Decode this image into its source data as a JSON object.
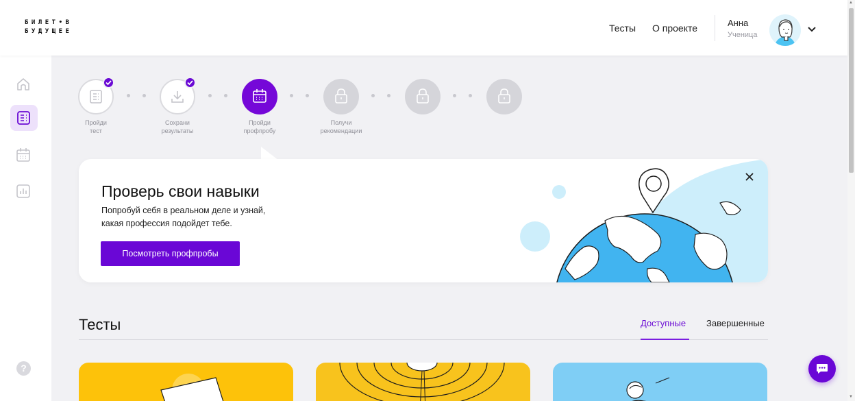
{
  "logo": {
    "line1": "БИЛЕТ•В",
    "line2": "БУДУЩЕЕ"
  },
  "header": {
    "nav": [
      {
        "label": "Тесты"
      },
      {
        "label": "О проекте"
      }
    ],
    "user": {
      "name": "Анна",
      "role": "Ученица"
    }
  },
  "sidebar": {
    "items": [
      {
        "icon": "home-icon",
        "active": false
      },
      {
        "icon": "list-icon",
        "active": true
      },
      {
        "icon": "calendar-icon",
        "active": false
      },
      {
        "icon": "chart-icon",
        "active": false
      }
    ],
    "help": "?"
  },
  "steps": [
    {
      "line1": "Пройди",
      "line2": "тест",
      "state": "done",
      "icon": "document-icon"
    },
    {
      "line1": "Сохрани",
      "line2": "результаты",
      "state": "done",
      "icon": "download-icon"
    },
    {
      "line1": "Пройди",
      "line2": "профпробу",
      "state": "active",
      "icon": "calendar-icon"
    },
    {
      "line1": "Получи",
      "line2": "рекомендации",
      "state": "locked",
      "icon": "lock-icon"
    },
    {
      "line1": "",
      "line2": "",
      "state": "locked",
      "icon": "lock-icon"
    },
    {
      "line1": "",
      "line2": "",
      "state": "locked",
      "icon": "lock-icon"
    }
  ],
  "banner": {
    "title": "Проверь свои навыки",
    "line1": "Попробуй себя в реальном деле и узнай,",
    "line2": "какая профессия подойдет тебе.",
    "button": "Посмотреть профпробы"
  },
  "tests": {
    "title": "Тесты",
    "tabs": [
      {
        "label": "Доступные",
        "active": true
      },
      {
        "label": "Завершенные",
        "active": false
      }
    ],
    "cards": [
      {
        "color": "#fdc20a"
      },
      {
        "color": "#f8c31d"
      },
      {
        "color": "#7fcef5"
      }
    ]
  },
  "colors": {
    "accent": "#6a07d6",
    "background": "#f1f1f4",
    "globe_ocean": "#41b4f0",
    "globe_land": "#ffffff"
  }
}
